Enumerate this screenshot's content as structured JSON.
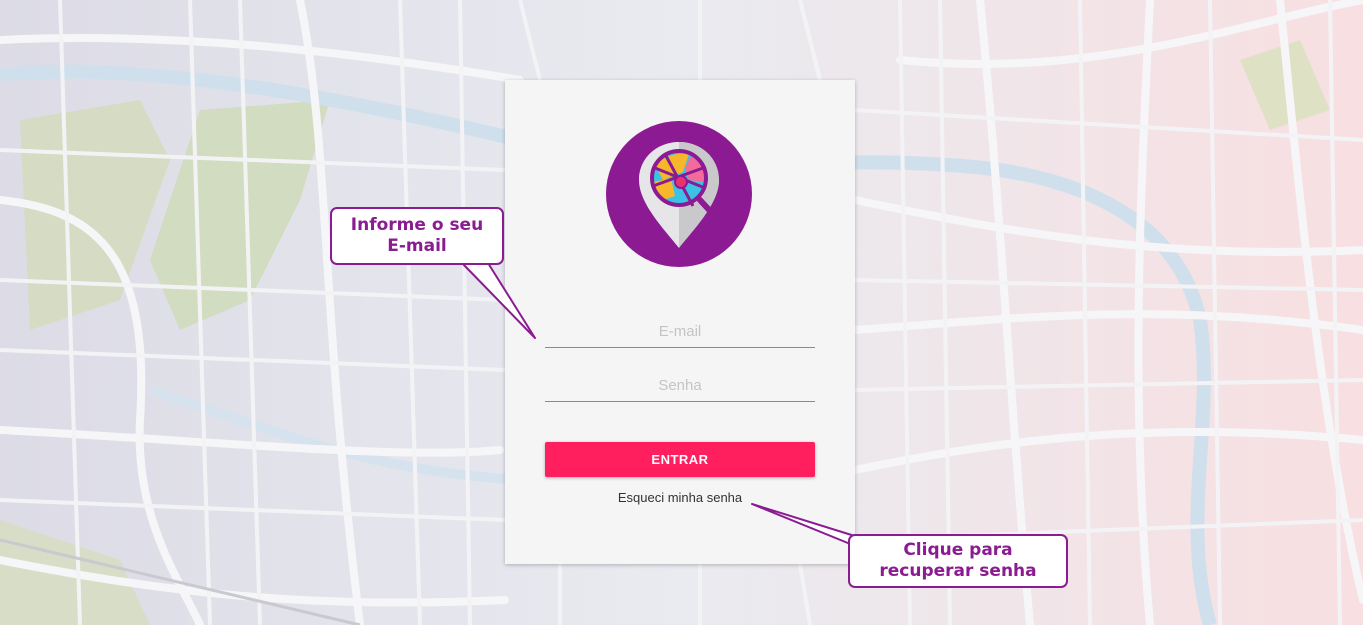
{
  "login": {
    "email_placeholder": "E-mail",
    "password_placeholder": "Senha",
    "submit_label": "ENTRAR",
    "forgot_password_label": "Esqueci minha senha"
  },
  "annotations": {
    "email_hint": "Informe o seu E-mail",
    "recover_hint": "Clique para recuperar senha"
  },
  "logo": {
    "icon": "map-pin-globe-icon"
  },
  "colors": {
    "brand_purple": "#8a1b91",
    "button_pink": "#ff1f5f",
    "card_bg": "#f5f5f5"
  }
}
